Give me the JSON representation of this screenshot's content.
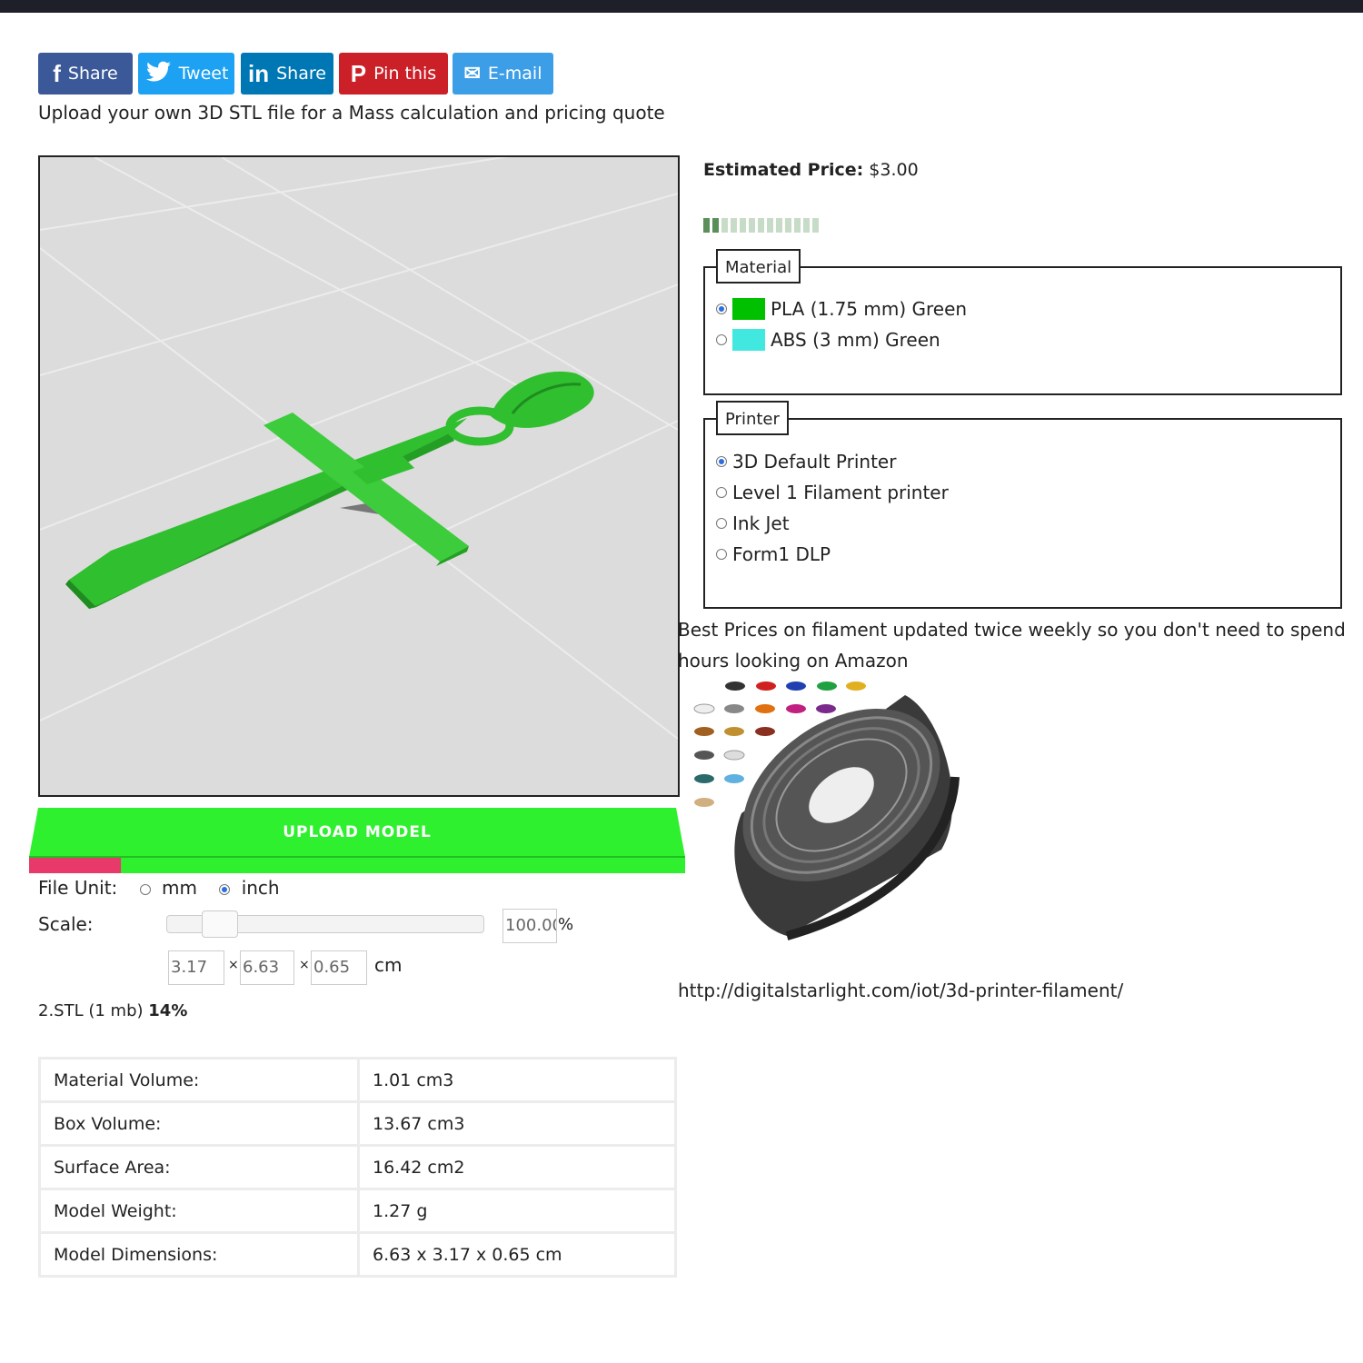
{
  "share": {
    "facebook": {
      "icon": "f",
      "label": "Share"
    },
    "twitter": {
      "icon": "t",
      "label": "Tweet"
    },
    "linkedin": {
      "icon": "in",
      "label": "Share"
    },
    "pinterest": {
      "icon": "P",
      "label": "Pin this"
    },
    "email": {
      "icon": "✉",
      "label": "E-mail"
    }
  },
  "intro": "Upload your own 3D STL file for a Mass calculation and pricing quote",
  "viewer": {
    "model_color": "#2fbf2f",
    "background": "#dcdcdc"
  },
  "upload": {
    "label": "UPLOAD MODEL",
    "progress": 0.14,
    "bar_color": "#2ef02e",
    "progress_color": "#e83a6a"
  },
  "file_unit": {
    "label": "File Unit:",
    "options": [
      "mm",
      "inch"
    ],
    "selected": "inch"
  },
  "scale": {
    "label": "Scale:",
    "value": "100.00",
    "unit": "%",
    "slider_fraction": 0.14
  },
  "dimensions": {
    "x": "3.17",
    "y": "6.63",
    "z": "0.65",
    "sep": "×",
    "unit": "cm"
  },
  "file": {
    "name": "2.STL (1 mb)",
    "percent": "14%"
  },
  "stats": [
    {
      "label": "Material Volume:",
      "value": "1.01 cm3"
    },
    {
      "label": "Box Volume:",
      "value": "13.67 cm3"
    },
    {
      "label": "Surface Area:",
      "value": "16.42 cm2"
    },
    {
      "label": "Model Weight:",
      "value": "1.27 g"
    },
    {
      "label": "Model Dimensions:",
      "value": "6.63 x 3.17 x 0.65 cm"
    }
  ],
  "price": {
    "label": "Estimated Price:",
    "value": "$3.00",
    "progress_filled": 2,
    "progress_total": 13
  },
  "material": {
    "legend": "Material",
    "options": [
      {
        "label": "PLA (1.75 mm) Green",
        "color": "#00c000",
        "selected": true
      },
      {
        "label": "ABS (3 mm) Green",
        "color": "#40e8e0",
        "selected": false
      }
    ]
  },
  "printer": {
    "legend": "Printer",
    "options": [
      {
        "label": "3D Default Printer",
        "selected": true
      },
      {
        "label": "Level 1 Filament printer",
        "selected": false
      },
      {
        "label": "Ink Jet",
        "selected": false
      },
      {
        "label": "Form1 DLP",
        "selected": false
      }
    ]
  },
  "ad": {
    "text": "Best Prices on filament updated twice weekly so you don't need to spend hours looking on Amazon",
    "link": "http://digitalstarlight.com/iot/3d-printer-filament/"
  }
}
